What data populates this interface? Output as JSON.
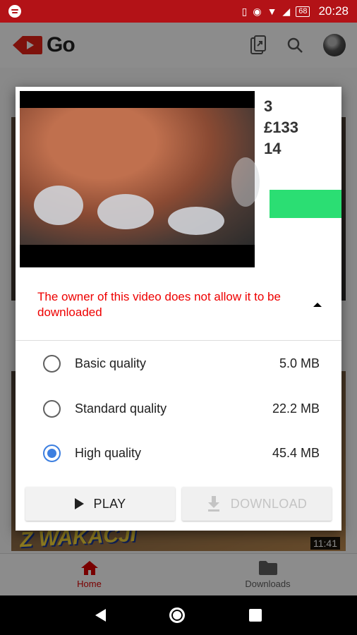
{
  "status_bar": {
    "time": "20:28",
    "battery": "68"
  },
  "app": {
    "title": "Go",
    "brand_color": "#e62117"
  },
  "feed": {
    "thumb_overlay_text": "Z WAKACJI",
    "duration": "11:41"
  },
  "dialog": {
    "preview": {
      "stat1": "3",
      "stat2": "£133",
      "stat3": "14"
    },
    "notice": "The owner of this video does not allow it to be downloaded",
    "options": [
      {
        "label": "Basic quality",
        "size": "5.0 MB",
        "selected": false
      },
      {
        "label": "Standard quality",
        "size": "22.2 MB",
        "selected": false
      },
      {
        "label": "High quality",
        "size": "45.4 MB",
        "selected": true
      }
    ],
    "play_label": "PLAY",
    "download_label": "DOWNLOAD"
  },
  "bottom_nav": {
    "home_label": "Home",
    "downloads_label": "Downloads"
  }
}
